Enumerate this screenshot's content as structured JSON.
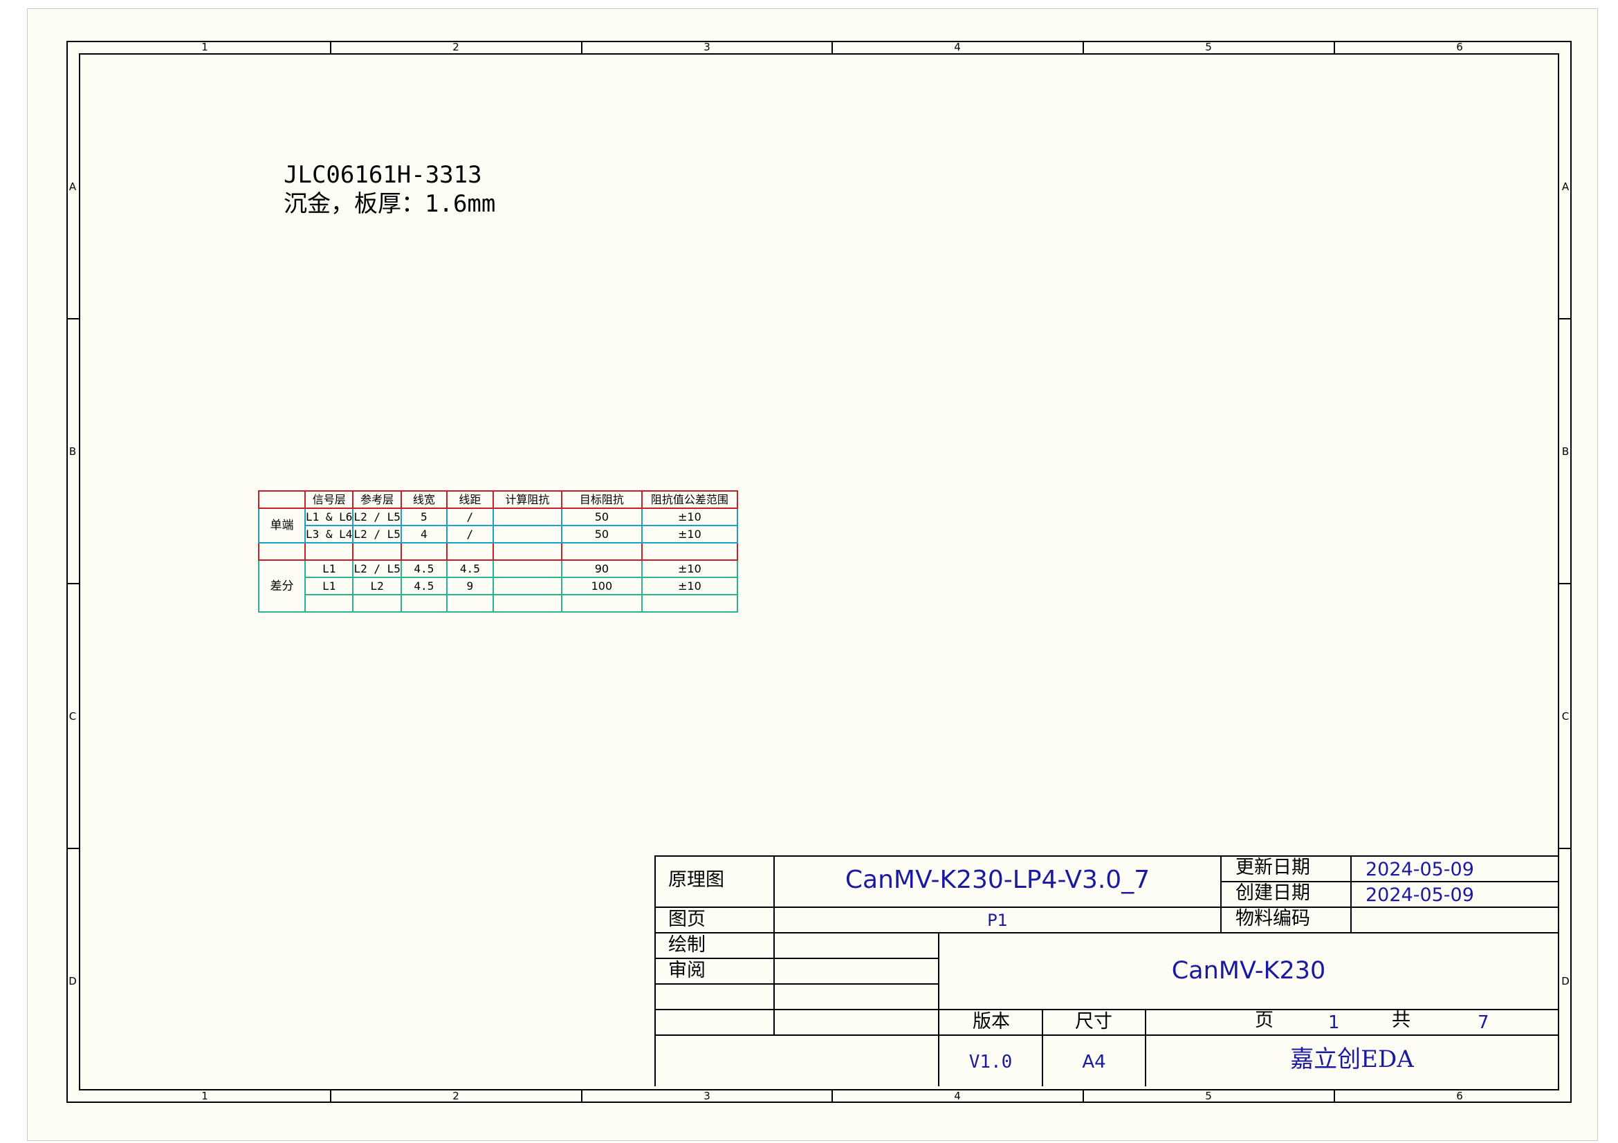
{
  "frame": {
    "columns": [
      "1",
      "2",
      "3",
      "4",
      "5",
      "6"
    ],
    "rows": [
      "A",
      "B",
      "C",
      "D"
    ]
  },
  "note": {
    "line1": "JLC06161H-3313",
    "line2": "沉金，板厚：1.6mm"
  },
  "impedance_table": {
    "headers": [
      "",
      "信号层",
      "参考层",
      "线宽",
      "线距",
      "计算阻抗",
      "目标阻抗",
      "阻抗值公差范围"
    ],
    "single_label": "单端",
    "diff_label": "差分",
    "single_rows": [
      [
        "L1 & L6",
        "L2 / L5",
        "5",
        "/",
        "",
        "50",
        "±10"
      ],
      [
        "L3 & L4",
        "L2 / L5",
        "4",
        "/",
        "",
        "50",
        "±10"
      ]
    ],
    "diff_rows": [
      [
        "L1",
        "L2 / L5",
        "4.5",
        "4.5",
        "",
        "90",
        "±10"
      ],
      [
        "L1",
        "L2",
        "4.5",
        "9",
        "",
        "100",
        "±10"
      ],
      [
        "",
        "",
        "",
        "",
        "",
        "",
        ""
      ]
    ]
  },
  "title_block": {
    "schematic_label": "原理图",
    "schematic_name": "CanMV-K230-LP4-V3.0_7",
    "update_date_label": "更新日期",
    "update_date": "2024-05-09",
    "create_date_label": "创建日期",
    "create_date": "2024-05-09",
    "sheet_label": "图页",
    "sheet_value": "P1",
    "material_code_label": "物料编码",
    "material_code": "",
    "drawn_label": "绘制",
    "review_label": "审阅",
    "project_name": "CanMV-K230",
    "version_label": "版本",
    "version": "V1.0",
    "size_label": "尺寸",
    "size": "A4",
    "page_label": "页",
    "page": "1",
    "total_label": "共",
    "total": "7",
    "company": "嘉立创EDA"
  }
}
